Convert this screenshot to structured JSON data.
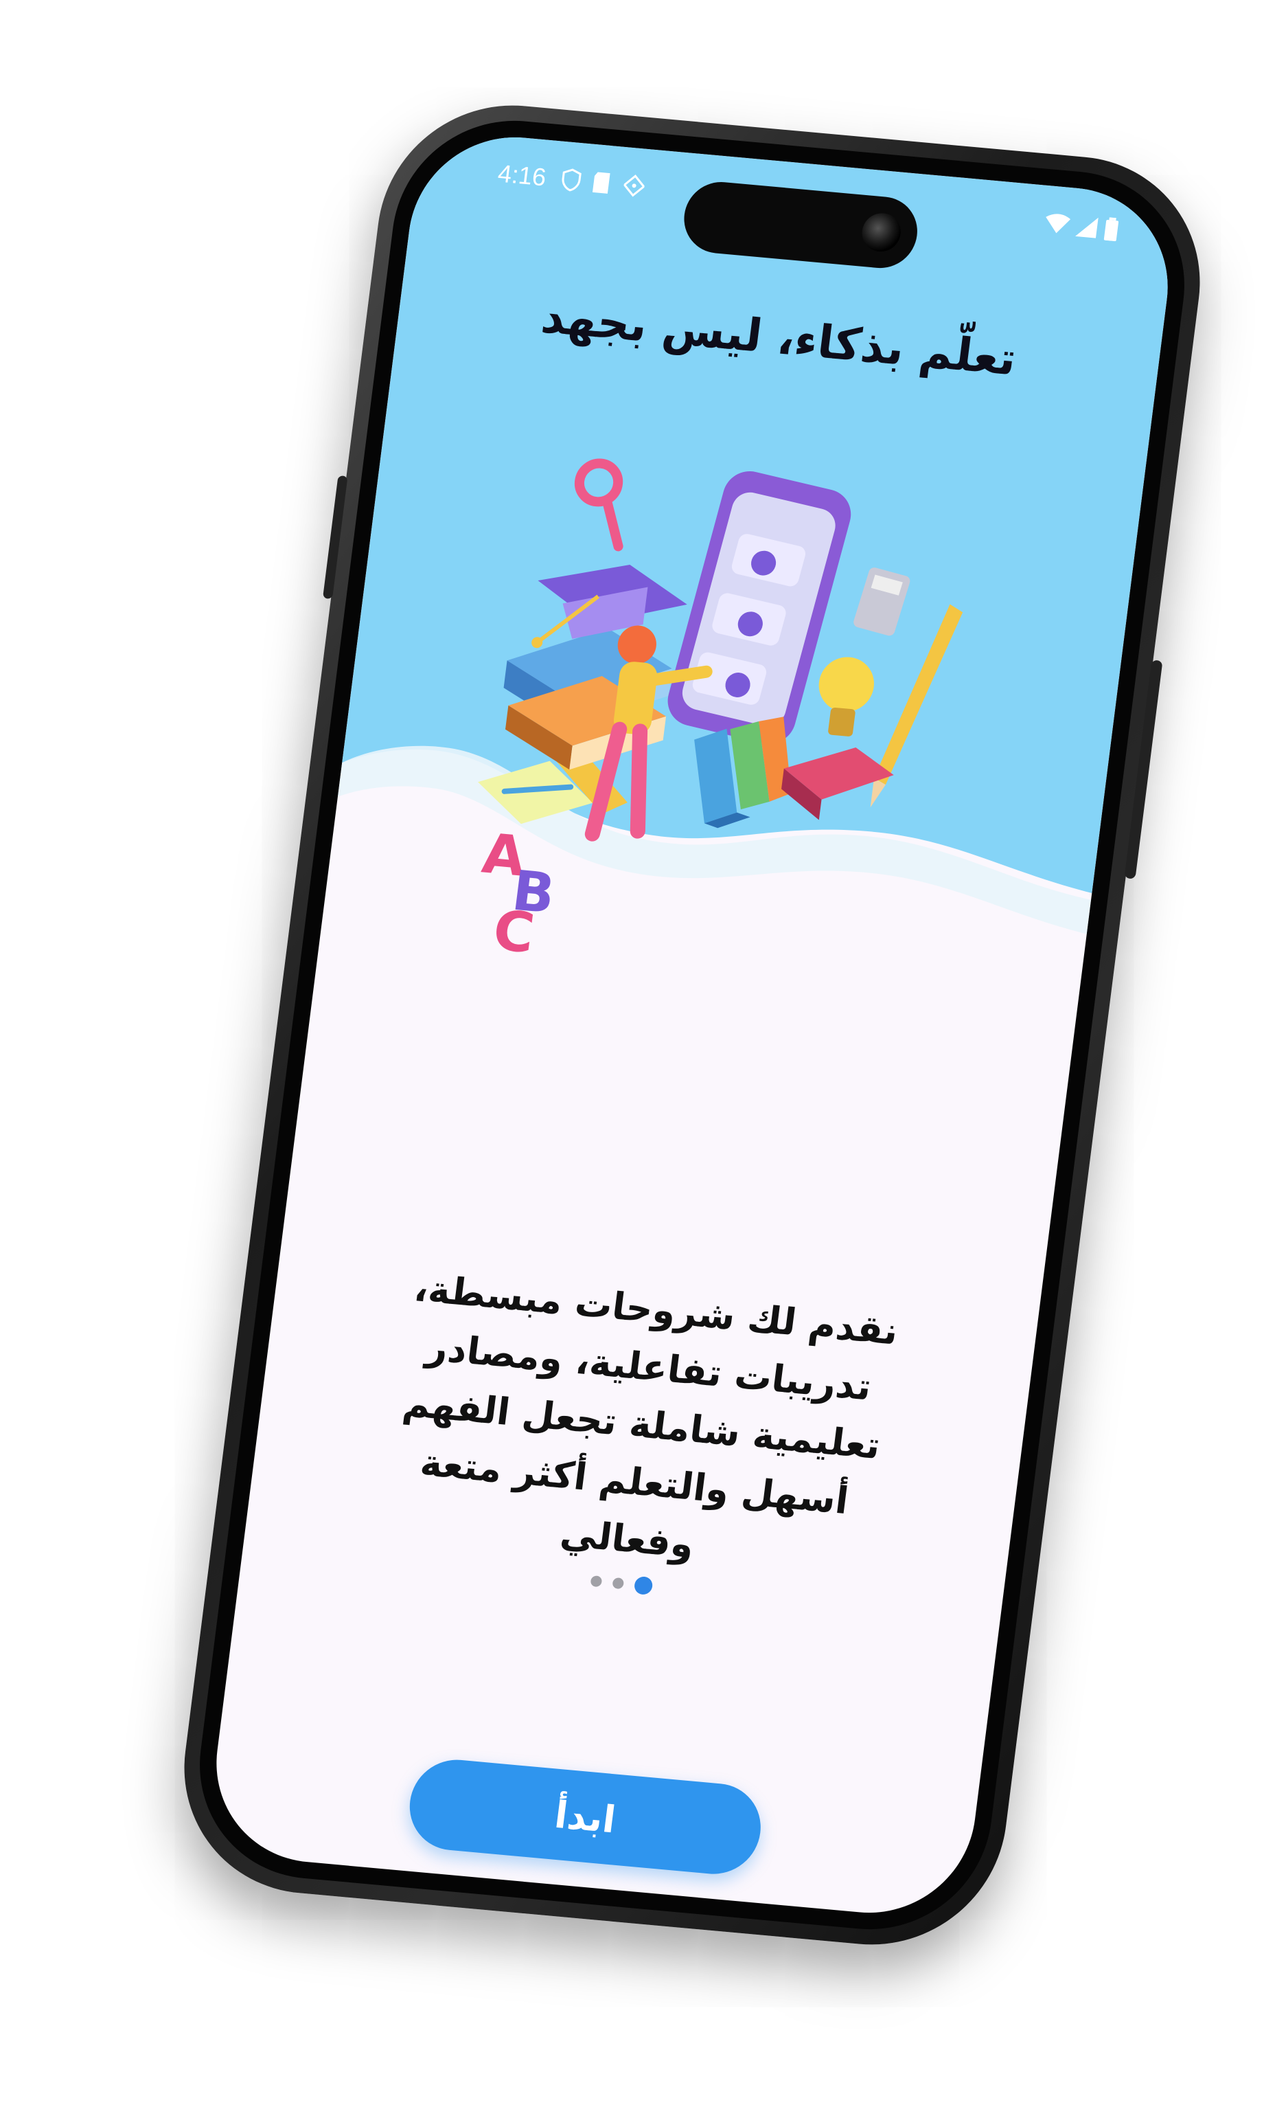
{
  "status_bar": {
    "time": "4:16",
    "left_icons": [
      "shield-icon",
      "sd-card-icon",
      "app-notification-icon"
    ],
    "right_icons": [
      "wifi-icon",
      "signal-icon",
      "battery-icon"
    ]
  },
  "onboarding": {
    "headline": "تعلّم بذكاء، ليس بجهد",
    "illustration_letters": [
      "A",
      "B",
      "C"
    ],
    "description": "نقدم لك شروحات مبسطة، تدريبات تفاعلية، ومصادر تعليمية شاملة تجعل الفهم أسهل والتعلم أكثر متعة وفعالي",
    "page_index": 3,
    "page_count": 3,
    "start_button_label": "ابدأ"
  },
  "colors": {
    "sky": "#85d4f7",
    "background": "#fbf7fd",
    "accent": "#2f95ee",
    "active_dot": "#2f86e6",
    "inactive_dot": "#a0a0a6"
  }
}
